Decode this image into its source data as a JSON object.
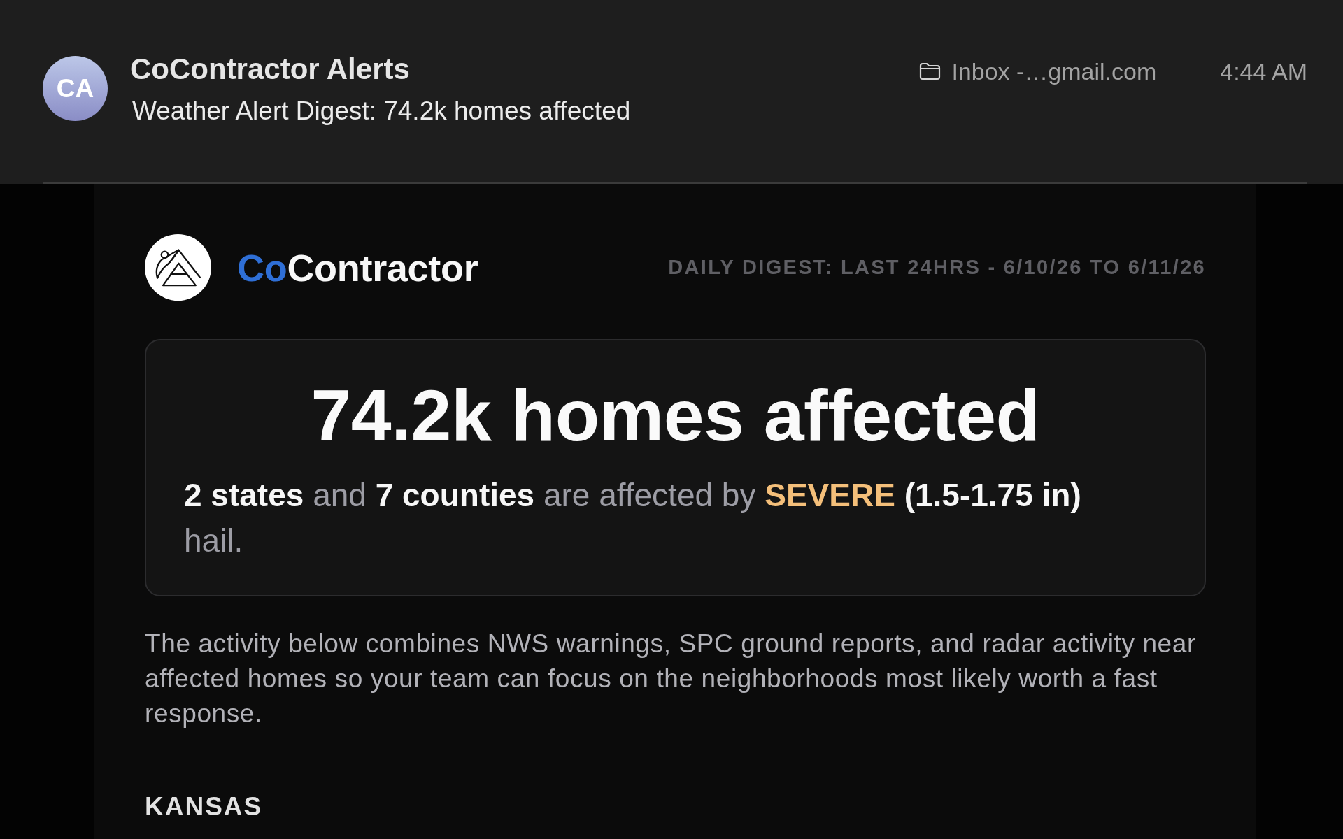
{
  "message": {
    "avatar_initials": "CA",
    "sender": "CoContractor Alerts",
    "subject": "Weather Alert Digest: 74.2k homes affected",
    "mailbox": "Inbox -…gmail.com",
    "time": "4:44 AM"
  },
  "brand": {
    "name_accent": "Co",
    "name_rest": "Contractor",
    "digest_range": "DAILY DIGEST: LAST 24HRS - 6/10/26 TO 6/11/26"
  },
  "summary_card": {
    "headline": "74.2k homes affected",
    "sentence": [
      {
        "text": "2 states",
        "kind": "emphasis"
      },
      {
        "text": "and",
        "kind": "plain"
      },
      {
        "text": "7 counties",
        "kind": "emphasis"
      },
      {
        "text": "are affected by",
        "kind": "plain"
      },
      {
        "text": "SEVERE",
        "kind": "severity"
      },
      {
        "text": "(1.5-1.75 in)",
        "kind": "emphasis"
      },
      {
        "text": "hail.",
        "kind": "plain"
      }
    ]
  },
  "intro": "The activity below combines NWS warnings, SPC ground reports, and radar activity near affected homes so your team can focus on the neighborhoods most likely worth a fast response.",
  "sections": [
    {
      "heading": "KANSAS"
    }
  ]
}
